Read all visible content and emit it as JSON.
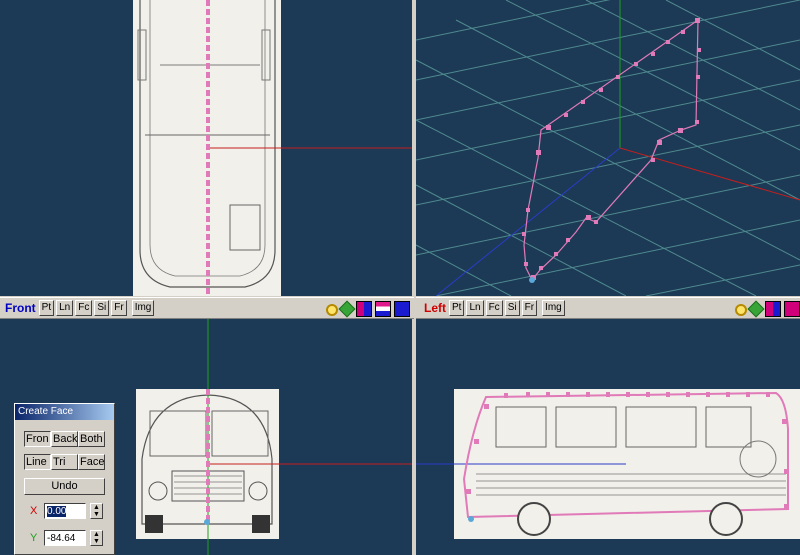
{
  "views": {
    "front": {
      "label": "Front",
      "label_color": "#0000c0",
      "buttons": [
        "Pt",
        "Ln",
        "Fc",
        "Si",
        "Fr",
        "Img"
      ]
    },
    "left": {
      "label": "Left",
      "label_color": "#d00000",
      "buttons": [
        "Pt",
        "Ln",
        "Fc",
        "Si",
        "Fr",
        "Img"
      ]
    }
  },
  "toolbar_icons": [
    "zoom-icon",
    "move-icon",
    "color-swap-icon",
    "color-stripe-icon",
    "color-blue-icon",
    "color-magenta-icon"
  ],
  "create_face": {
    "title": "Create Face",
    "side_buttons": [
      "Fron",
      "Back",
      "Both"
    ],
    "mode_buttons": [
      "Line",
      "Tri",
      "Face"
    ],
    "undo_label": "Undo",
    "x_label": "X",
    "x_value": "0.00",
    "y_label": "Y",
    "y_value": "-84.64"
  },
  "colors": {
    "viewport_bg": "#1c3a55",
    "grid": "#4f8a8f",
    "vertex": "#e07ab8",
    "axis_red": "#c41e1e",
    "axis_green": "#1ea01e",
    "axis_blue": "#2a3cc8"
  }
}
